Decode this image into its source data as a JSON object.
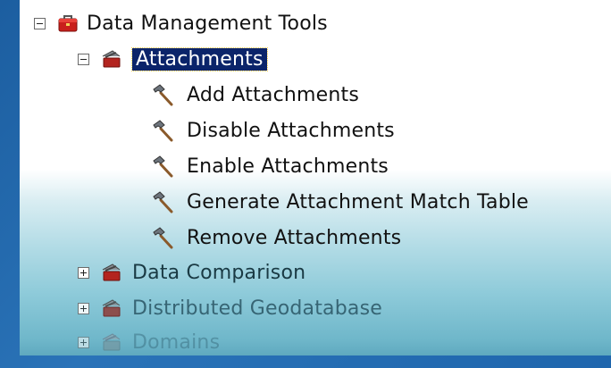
{
  "tree": {
    "root": {
      "label": "Data Management Tools",
      "expanded": true,
      "icon": "toolbox-icon"
    },
    "attachments": {
      "label": "Attachments",
      "expanded": true,
      "selected": true,
      "icon": "toolset-icon",
      "tools": [
        {
          "label": "Add Attachments",
          "icon": "hammer-icon"
        },
        {
          "label": "Disable Attachments",
          "icon": "hammer-icon"
        },
        {
          "label": "Enable Attachments",
          "icon": "hammer-icon"
        },
        {
          "label": "Generate Attachment Match Table",
          "icon": "hammer-icon"
        },
        {
          "label": "Remove Attachments",
          "icon": "hammer-icon"
        }
      ]
    },
    "collapsed_toolsets": [
      {
        "label": "Data Comparison",
        "expanded": false,
        "icon": "toolset-icon"
      },
      {
        "label": "Distributed Geodatabase",
        "expanded": false,
        "icon": "toolset-icon"
      },
      {
        "label": "Domains",
        "expanded": false,
        "icon": "toolset-icon"
      }
    ]
  },
  "colors": {
    "selection_background": "#0b246a",
    "selection_text": "#ffffff",
    "slide_background": "#2a73b8"
  }
}
